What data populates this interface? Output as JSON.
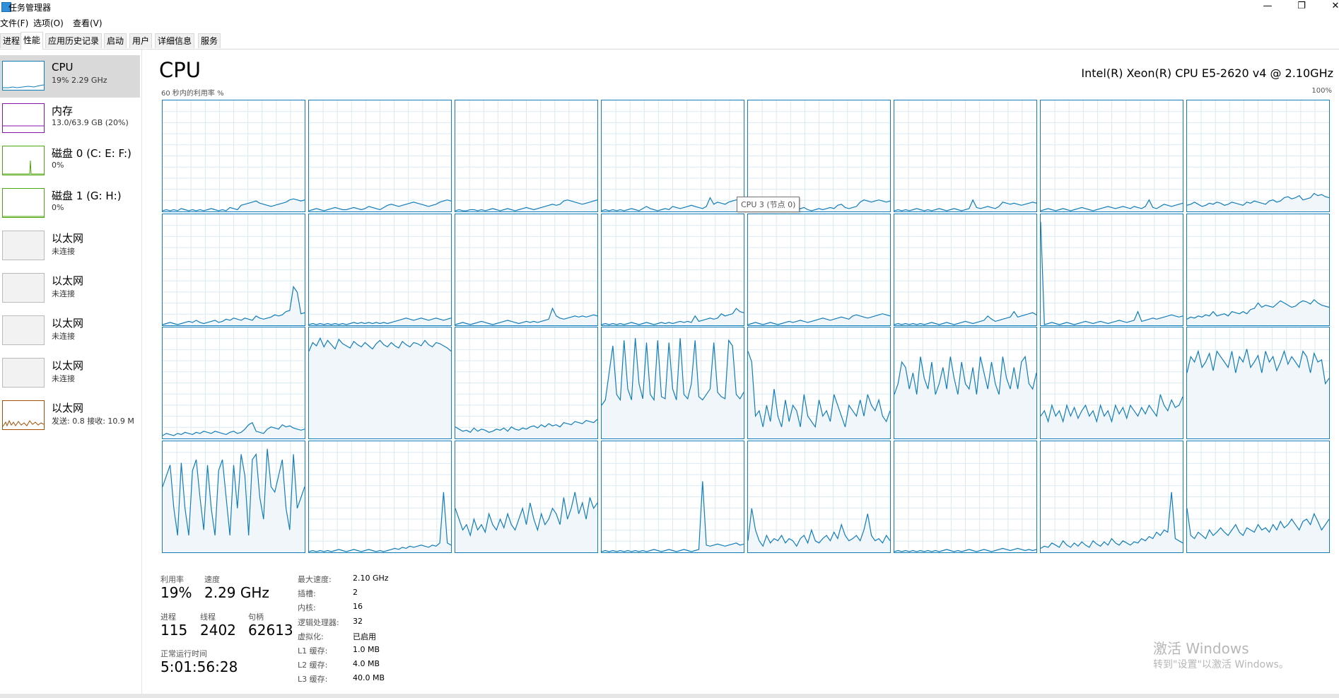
{
  "window": {
    "title": "任务管理器",
    "minimize_glyph": "—",
    "maximize_glyph": "❐",
    "close_glyph": "✕"
  },
  "menu": [
    "文件(F)",
    "选项(O)",
    "查看(V)"
  ],
  "tabs": [
    "进程",
    "性能",
    "应用历史记录",
    "启动",
    "用户",
    "详细信息",
    "服务"
  ],
  "active_tab": "性能",
  "sidebar": {
    "items": [
      {
        "title": "CPU",
        "sub": "19% 2.29 GHz",
        "color": "#117dbb",
        "active": true
      },
      {
        "title": "内存",
        "sub": "13.0/63.9 GB (20%)",
        "color": "#8b12ae"
      },
      {
        "title": "磁盘 0 (C: E: F:)",
        "sub": "0%",
        "color": "#4da60c"
      },
      {
        "title": "磁盘 1 (G: H:)",
        "sub": "0%",
        "color": "#4da60c"
      },
      {
        "title": "以太网",
        "sub": "未连接",
        "color": "#bbbbbb"
      },
      {
        "title": "以太网",
        "sub": "未连接",
        "color": "#bbbbbb"
      },
      {
        "title": "以太网",
        "sub": "未连接",
        "color": "#bbbbbb"
      },
      {
        "title": "以太网",
        "sub": "未连接",
        "color": "#bbbbbb"
      },
      {
        "title": "以太网",
        "sub": "发送: 0.8 接收: 10.9 M",
        "color": "#a74f01"
      }
    ]
  },
  "main": {
    "heading": "CPU",
    "model": "Intel(R) Xeon(R) CPU E5-2620 v4 @ 2.10GHz",
    "graph_caption": "60 秒内的利用率 %",
    "graph_max": "100%",
    "tooltip": "CPU 3 (节点 0)",
    "graph_color": "#117dbb",
    "graph_fill": "#f1f6fa",
    "grid_color": "#d9eaf4"
  },
  "stats": {
    "utilization_label": "利用率",
    "utilization": "19%",
    "speed_label": "速度",
    "speed": "2.29 GHz",
    "processes_label": "进程",
    "processes": "115",
    "threads_label": "线程",
    "threads": "2402",
    "handles_label": "句柄",
    "handles": "62613",
    "uptime_label": "正常运行时间",
    "uptime": "5:01:56:28"
  },
  "specs": [
    {
      "label": "最大速度:",
      "value": "2.10 GHz"
    },
    {
      "label": "插槽:",
      "value": "2"
    },
    {
      "label": "内核:",
      "value": "16"
    },
    {
      "label": "逻辑处理器:",
      "value": "32"
    },
    {
      "label": "虚拟化:",
      "value": "已启用"
    },
    {
      "label": "L1 缓存:",
      "value": "1.0 MB"
    },
    {
      "label": "L2 缓存:",
      "value": "4.0 MB"
    },
    {
      "label": "L3 缓存:",
      "value": "40.0 MB"
    }
  ],
  "watermark": {
    "line1": "激活 Windows",
    "line2": "转到\"设置\"以激活 Windows。"
  },
  "cores": [
    [
      0,
      1,
      0,
      1,
      0,
      2,
      1,
      0,
      1,
      0,
      1,
      0,
      1,
      2,
      1,
      0,
      1,
      0,
      3,
      2,
      1,
      5,
      6,
      7,
      8,
      9,
      7,
      6,
      5,
      4,
      5,
      6,
      7,
      8,
      10,
      11,
      10,
      9,
      10
    ],
    [
      0,
      1,
      2,
      1,
      0,
      1,
      2,
      3,
      2,
      1,
      1,
      2,
      3,
      2,
      1,
      2,
      4,
      3,
      2,
      1,
      3,
      5,
      6,
      5,
      4,
      5,
      6,
      7,
      8,
      7,
      6,
      5,
      4,
      5,
      6,
      8,
      9,
      10,
      9
    ],
    [
      0,
      1,
      0,
      0,
      1,
      1,
      0,
      1,
      0,
      1,
      2,
      1,
      0,
      1,
      2,
      1,
      0,
      1,
      2,
      3,
      2,
      1,
      2,
      3,
      4,
      5,
      6,
      5,
      6,
      9,
      10,
      9,
      8,
      7,
      6,
      7,
      8,
      9,
      10
    ],
    [
      0,
      1,
      0,
      1,
      0,
      1,
      0,
      1,
      2,
      1,
      0,
      2,
      4,
      2,
      1,
      0,
      1,
      2,
      1,
      4,
      3,
      2,
      3,
      4,
      5,
      4,
      3,
      2,
      4,
      12,
      6,
      8,
      7,
      6,
      8,
      9,
      10,
      11,
      9
    ],
    [
      0,
      1,
      2,
      1,
      0,
      1,
      2,
      1,
      0,
      1,
      2,
      1,
      0,
      1,
      2,
      3,
      1,
      0,
      1,
      2,
      1,
      2,
      3,
      2,
      5,
      6,
      3,
      2,
      3,
      4,
      8,
      10,
      9,
      8,
      9,
      10,
      9,
      8,
      9
    ],
    [
      0,
      1,
      0,
      1,
      0,
      1,
      2,
      1,
      0,
      1,
      0,
      1,
      2,
      1,
      0,
      1,
      2,
      1,
      0,
      1,
      2,
      10,
      3,
      2,
      3,
      4,
      3,
      2,
      4,
      8,
      7,
      6,
      7,
      6,
      5,
      6,
      7,
      8,
      7
    ],
    [
      0,
      1,
      2,
      1,
      0,
      1,
      2,
      1,
      0,
      1,
      2,
      3,
      2,
      1,
      0,
      1,
      2,
      3,
      4,
      3,
      2,
      3,
      4,
      3,
      2,
      4,
      3,
      2,
      4,
      10,
      3,
      2,
      4,
      6,
      5,
      4,
      5,
      6,
      7
    ],
    [
      5,
      6,
      8,
      6,
      4,
      5,
      7,
      6,
      8,
      7,
      5,
      6,
      8,
      7,
      6,
      5,
      8,
      7,
      9,
      8,
      7,
      6,
      9,
      10,
      8,
      9,
      12,
      13,
      11,
      12,
      14,
      10,
      11,
      12,
      16,
      14,
      15,
      13,
      12
    ],
    [
      0,
      1,
      2,
      1,
      0,
      1,
      2,
      3,
      2,
      4,
      2,
      1,
      2,
      3,
      4,
      2,
      3,
      5,
      4,
      6,
      5,
      4,
      6,
      5,
      4,
      8,
      6,
      5,
      6,
      7,
      9,
      8,
      9,
      12,
      13,
      35,
      30,
      10,
      11
    ],
    [
      0,
      1,
      0,
      1,
      0,
      1,
      0,
      1,
      0,
      1,
      0,
      1,
      2,
      1,
      2,
      1,
      2,
      1,
      2,
      1,
      2,
      1,
      2,
      3,
      4,
      5,
      6,
      5,
      4,
      5,
      6,
      5,
      4,
      5,
      6,
      5,
      4,
      5,
      6
    ],
    [
      0,
      1,
      2,
      1,
      0,
      1,
      2,
      3,
      2,
      1,
      0,
      1,
      2,
      3,
      4,
      3,
      2,
      1,
      2,
      3,
      2,
      3,
      2,
      3,
      4,
      5,
      15,
      8,
      6,
      5,
      6,
      7,
      8,
      7,
      8,
      7,
      8,
      9,
      8
    ],
    [
      0,
      1,
      0,
      1,
      0,
      1,
      0,
      1,
      2,
      1,
      0,
      1,
      2,
      1,
      0,
      1,
      2,
      1,
      2,
      1,
      2,
      3,
      2,
      3,
      2,
      8,
      3,
      4,
      5,
      6,
      5,
      6,
      10,
      8,
      9,
      10,
      15,
      12,
      11
    ],
    [
      0,
      1,
      2,
      1,
      0,
      1,
      2,
      1,
      0,
      1,
      2,
      3,
      2,
      3,
      4,
      3,
      2,
      3,
      4,
      5,
      6,
      5,
      4,
      5,
      6,
      7,
      6,
      5,
      8,
      9,
      8,
      7,
      6,
      7,
      8,
      9,
      10,
      9,
      8
    ],
    [
      0,
      1,
      0,
      1,
      0,
      1,
      0,
      1,
      0,
      1,
      2,
      1,
      0,
      1,
      2,
      1,
      0,
      1,
      2,
      3,
      2,
      1,
      2,
      3,
      4,
      8,
      5,
      3,
      4,
      5,
      6,
      7,
      12,
      7,
      8,
      9,
      10,
      11,
      9
    ],
    [
      95,
      0,
      1,
      2,
      1,
      0,
      1,
      2,
      1,
      0,
      1,
      2,
      3,
      2,
      1,
      2,
      3,
      2,
      1,
      2,
      3,
      4,
      3,
      2,
      3,
      4,
      12,
      3,
      4,
      5,
      6,
      5,
      6,
      7,
      8,
      9,
      8,
      7,
      8
    ],
    [
      5,
      7,
      6,
      8,
      7,
      9,
      8,
      12,
      8,
      9,
      10,
      8,
      12,
      11,
      10,
      12,
      10,
      14,
      15,
      20,
      16,
      18,
      17,
      16,
      19,
      22,
      20,
      18,
      16,
      17,
      20,
      22,
      21,
      19,
      23,
      20,
      18,
      17,
      16
    ],
    [
      2,
      4,
      3,
      2,
      4,
      3,
      5,
      4,
      3,
      5,
      4,
      6,
      5,
      4,
      6,
      5,
      4,
      3,
      5,
      6,
      4,
      5,
      8,
      12,
      14,
      6,
      5,
      4,
      8,
      10,
      9,
      8,
      12,
      10,
      11,
      9,
      8,
      7,
      8
    ],
    [
      80,
      88,
      85,
      92,
      84,
      90,
      86,
      82,
      91,
      87,
      85,
      83,
      89,
      86,
      84,
      88,
      85,
      82,
      87,
      90,
      86,
      84,
      88,
      85,
      83,
      89,
      86,
      84,
      88,
      87,
      85,
      90,
      86,
      84,
      88,
      87,
      85,
      83,
      80
    ],
    [
      10,
      8,
      6,
      7,
      5,
      9,
      6,
      8,
      7,
      5,
      6,
      8,
      7,
      9,
      6,
      10,
      8,
      7,
      9,
      8,
      10,
      11,
      9,
      12,
      10,
      13,
      11,
      12,
      10,
      14,
      13,
      12,
      15,
      14,
      13,
      16,
      15,
      14,
      17
    ],
    [
      30,
      35,
      60,
      85,
      40,
      35,
      90,
      45,
      35,
      92,
      50,
      36,
      88,
      40,
      35,
      90,
      38,
      36,
      88,
      45,
      35,
      92,
      40,
      36,
      50,
      90,
      38,
      35,
      40,
      45,
      88,
      42,
      38,
      36,
      90,
      85,
      40,
      36,
      42
    ],
    [
      80,
      70,
      20,
      25,
      10,
      30,
      15,
      45,
      20,
      10,
      35,
      15,
      30,
      25,
      10,
      40,
      20,
      15,
      10,
      35,
      20,
      25,
      15,
      40,
      30,
      20,
      10,
      30,
      25,
      20,
      35,
      20,
      40,
      30,
      25,
      35,
      20,
      15,
      25
    ],
    [
      40,
      50,
      70,
      65,
      45,
      60,
      40,
      75,
      55,
      45,
      70,
      40,
      50,
      65,
      45,
      75,
      55,
      40,
      70,
      50,
      45,
      65,
      40,
      75,
      60,
      45,
      70,
      50,
      40,
      75,
      55,
      45,
      65,
      45,
      70,
      75,
      50,
      45,
      60
    ],
    [
      20,
      25,
      15,
      30,
      20,
      25,
      15,
      30,
      20,
      28,
      18,
      25,
      30,
      20,
      25,
      15,
      30,
      20,
      25,
      15,
      30,
      22,
      28,
      18,
      30,
      25,
      20,
      28,
      22,
      30,
      25,
      20,
      40,
      30,
      25,
      35,
      28,
      30,
      38
    ],
    [
      60,
      75,
      70,
      80,
      65,
      70,
      78,
      62,
      80,
      75,
      70,
      65,
      80,
      60,
      75,
      70,
      82,
      65,
      70,
      76,
      60,
      80,
      70,
      75,
      62,
      70,
      80,
      68,
      75,
      70,
      65,
      80,
      75,
      60,
      78,
      70,
      72,
      50,
      55
    ],
    [
      60,
      70,
      80,
      40,
      15,
      82,
      40,
      15,
      75,
      85,
      50,
      20,
      80,
      40,
      15,
      75,
      85,
      50,
      15,
      80,
      40,
      90,
      70,
      15,
      85,
      90,
      50,
      30,
      95,
      60,
      55,
      70,
      85,
      40,
      20,
      90,
      40,
      50,
      60
    ],
    [
      0,
      1,
      0,
      1,
      0,
      1,
      0,
      1,
      2,
      1,
      0,
      1,
      2,
      1,
      0,
      1,
      2,
      1,
      0,
      1,
      0,
      1,
      2,
      3,
      2,
      4,
      3,
      5,
      4,
      5,
      6,
      5,
      4,
      6,
      5,
      8,
      55,
      8,
      6
    ],
    [
      40,
      30,
      20,
      25,
      15,
      30,
      20,
      25,
      18,
      35,
      25,
      20,
      30,
      22,
      35,
      25,
      20,
      30,
      40,
      25,
      45,
      30,
      20,
      35,
      25,
      30,
      40,
      35,
      25,
      50,
      30,
      40,
      55,
      35,
      45,
      30,
      50,
      40,
      45
    ],
    [
      0,
      1,
      0,
      1,
      0,
      1,
      0,
      1,
      0,
      1,
      0,
      1,
      0,
      1,
      2,
      1,
      0,
      1,
      2,
      1,
      0,
      1,
      2,
      1,
      0,
      1,
      2,
      65,
      6,
      5,
      6,
      7,
      6,
      5,
      6,
      7,
      8,
      6,
      7
    ],
    [
      10,
      40,
      20,
      10,
      5,
      15,
      8,
      12,
      10,
      15,
      8,
      12,
      10,
      5,
      12,
      15,
      8,
      20,
      10,
      8,
      12,
      15,
      10,
      18,
      12,
      25,
      15,
      10,
      12,
      15,
      10,
      20,
      35,
      15,
      10,
      12,
      8,
      15,
      10
    ],
    [
      0,
      1,
      0,
      1,
      0,
      1,
      0,
      1,
      0,
      1,
      0,
      1,
      0,
      1,
      2,
      1,
      0,
      1,
      0,
      1,
      2,
      1,
      0,
      1,
      2,
      1,
      0,
      1,
      2,
      3,
      2,
      1,
      2,
      3,
      2,
      1,
      2,
      1,
      2
    ],
    [
      3,
      5,
      4,
      8,
      6,
      4,
      10,
      6,
      4,
      8,
      5,
      9,
      6,
      4,
      10,
      7,
      5,
      9,
      6,
      12,
      8,
      6,
      10,
      8,
      6,
      9,
      8,
      12,
      10,
      14,
      12,
      18,
      15,
      20,
      18,
      55,
      12,
      10,
      8
    ],
    [
      40,
      15,
      12,
      18,
      15,
      12,
      20,
      15,
      18,
      22,
      18,
      15,
      20,
      25,
      18,
      15,
      22,
      20,
      18,
      25,
      20,
      22,
      18,
      25,
      20,
      28,
      22,
      25,
      30,
      25,
      20,
      28,
      30,
      25,
      35,
      28,
      20,
      25,
      30
    ]
  ]
}
